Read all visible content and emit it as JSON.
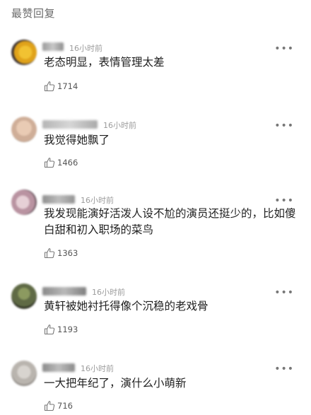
{
  "section": {
    "title": "最赞回复"
  },
  "comments": [
    {
      "time": "16小时前",
      "text": "老态明显，表情管理太差",
      "likes": "1714",
      "more_icon": "more-horizontal-icon",
      "like_icon": "thumb-up-icon",
      "avatar_color": "#e0a21a"
    },
    {
      "time": "16小时前",
      "text": "我觉得她飘了",
      "likes": "1466",
      "more_icon": "more-horizontal-icon",
      "like_icon": "thumb-up-icon",
      "avatar_color": "#d9b6a0"
    },
    {
      "time": "16小时前",
      "text": "我发现能演好活泼人设不尬的演员还挺少的，比如傻白甜和初入职场的菜鸟",
      "likes": "1363",
      "more_icon": "more-horizontal-icon",
      "like_icon": "thumb-up-icon",
      "avatar_color": "#c9a7b3"
    },
    {
      "time": "16小时前",
      "text": "黄轩被她衬托得像个沉稳的老戏骨",
      "likes": "1193",
      "more_icon": "more-horizontal-icon",
      "like_icon": "thumb-up-icon",
      "avatar_color": "#5f6a45"
    },
    {
      "time": "16小时前",
      "text": "一大把年纪了，演什么小萌新",
      "likes": "716",
      "more_icon": "more-horizontal-icon",
      "like_icon": "thumb-up-icon",
      "avatar_color": "#b9b4ae"
    }
  ]
}
